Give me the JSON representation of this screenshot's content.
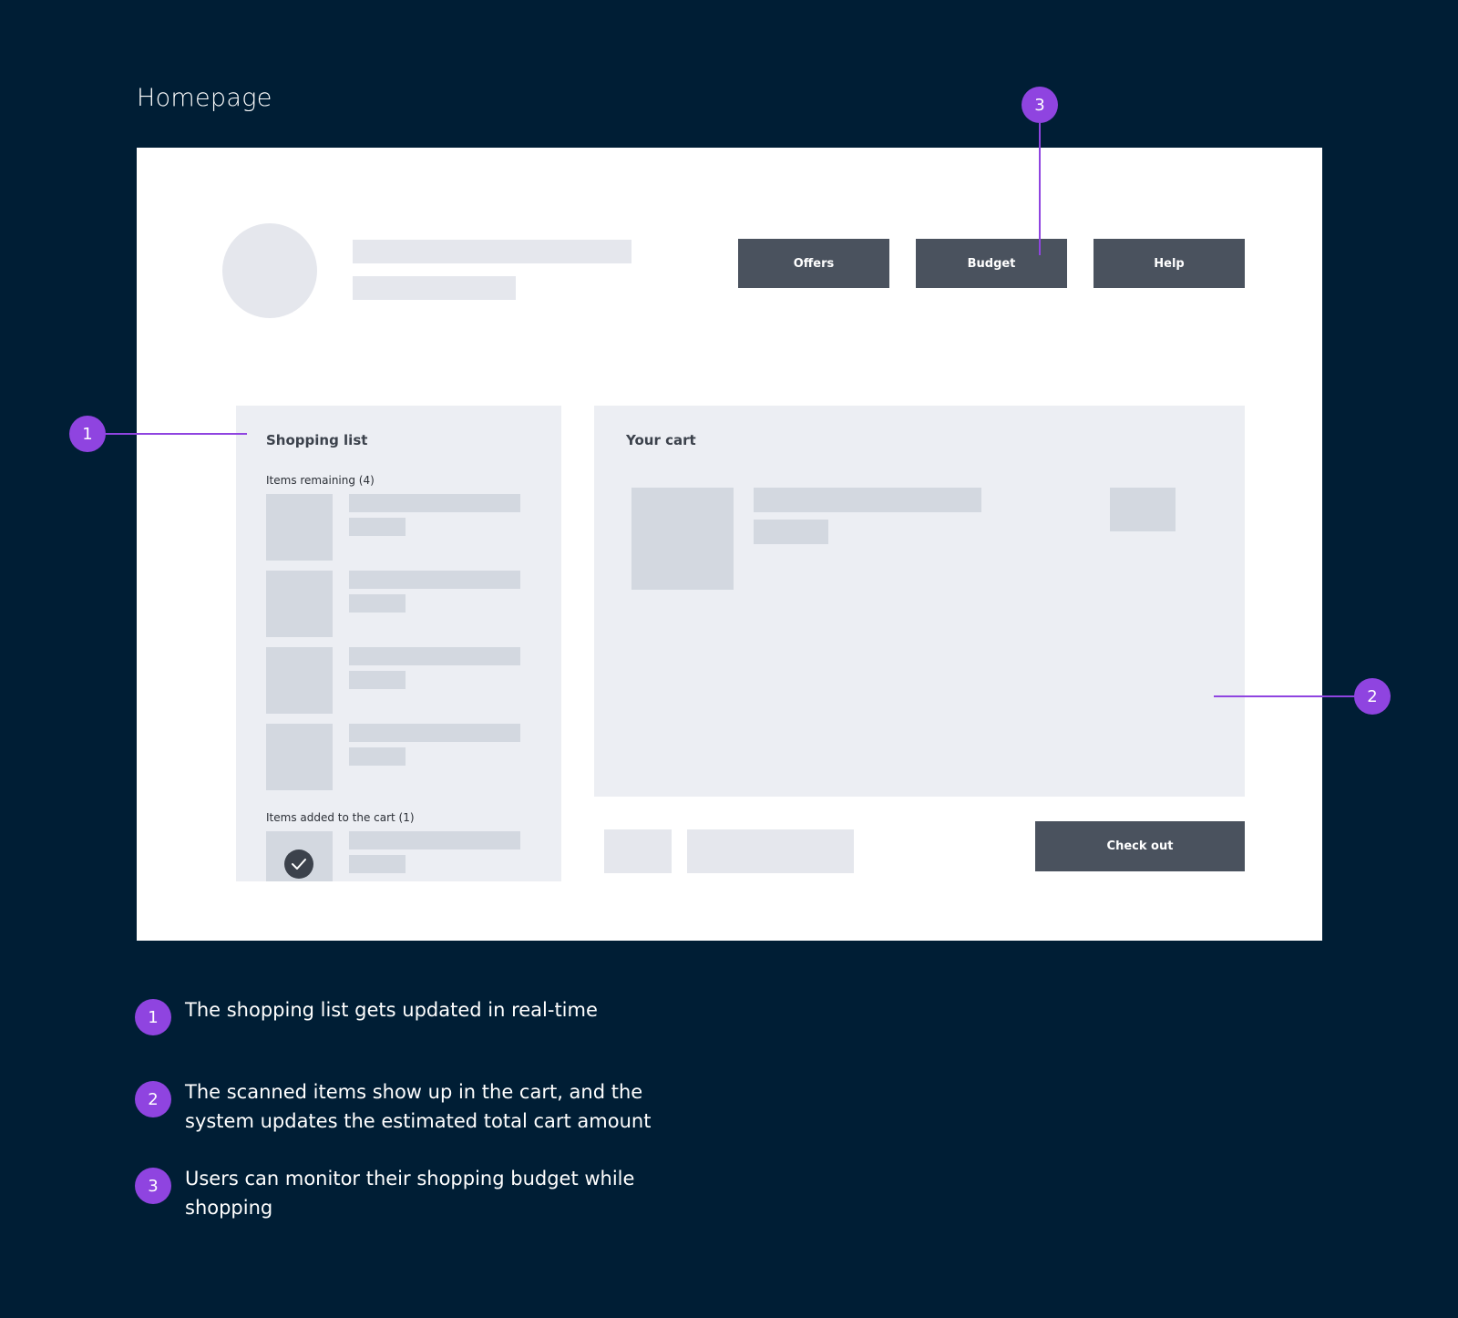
{
  "page_title": "Homepage",
  "header": {
    "buttons": [
      {
        "label": "Offers"
      },
      {
        "label": "Budget"
      },
      {
        "label": "Help"
      }
    ]
  },
  "shopping_list": {
    "title": "Shopping list",
    "remaining_label": "Items remaining (4)",
    "added_label": "Items added to the cart (1)"
  },
  "cart": {
    "title": "Your cart",
    "checkout_label": "Check out"
  },
  "callouts": [
    {
      "number": "1",
      "text": "The shopping list gets updated in real-time"
    },
    {
      "number": "2",
      "text": "The scanned items show up in the cart, and the system updates the estimated total cart amount"
    },
    {
      "number": "3",
      "text": "Users can monitor their shopping budget while shopping"
    }
  ],
  "colors": {
    "background": "#001e35",
    "accent": "#8f44e0",
    "button": "#4a525e",
    "placeholder": "#e5e7ed"
  }
}
